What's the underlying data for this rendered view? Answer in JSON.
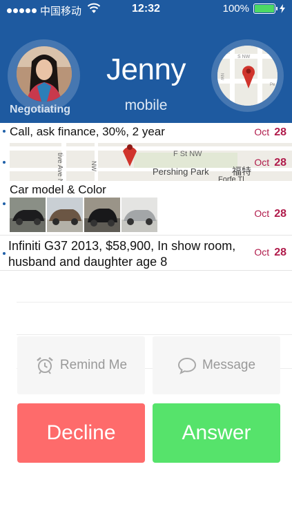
{
  "status_bar": {
    "carrier": "中国移动",
    "time": "12:32",
    "battery_percent": "100%",
    "battery_level": 1.0,
    "signal_bars": 5,
    "icons": [
      "signal-dots-icon",
      "wifi-icon",
      "battery-icon",
      "charging-bolt-icon"
    ]
  },
  "caller": {
    "name": "Jenny",
    "type": "mobile",
    "status": "Negotiating",
    "avatar_icon": "caller-photo"
  },
  "mini_map": {
    "label_street": "S NW",
    "label_avenue": "NW",
    "label_partial": "Pe",
    "pin_icon": "map-pin-icon"
  },
  "notes": [
    {
      "text": "Call, ask finance, 30%, 2 year",
      "month": "Oct",
      "day": "28"
    },
    {
      "type": "map",
      "month": "Oct",
      "day": "28",
      "map_labels": {
        "avenue": "tive Ave N",
        "street_nw": "F St NW",
        "nw": "NW",
        "park": "Pershing Park",
        "chinese": "福特",
        "partial": "Forfe Tl"
      }
    },
    {
      "text": "Car model & Color",
      "month": "Oct",
      "day": "28",
      "photos": [
        "black-suv-photo",
        "bronze-suv-photo",
        "black-suv-rear-photo",
        "silver-suv-photo"
      ]
    },
    {
      "text_line1": "Infiniti G37 2013, $58,900, In show room,",
      "text_line2": "husband and daughter age 8",
      "month": "Oct",
      "day": "28"
    }
  ],
  "actions": {
    "remind_label": "Remind Me",
    "message_label": "Message",
    "decline_label": "Decline",
    "answer_label": "Answer"
  },
  "colors": {
    "header_blue": "#1e5aa0",
    "date_red": "#b01a4a",
    "decline_red": "#fe6b6b",
    "answer_green": "#56e36b",
    "bullet_blue": "#2060a8"
  }
}
